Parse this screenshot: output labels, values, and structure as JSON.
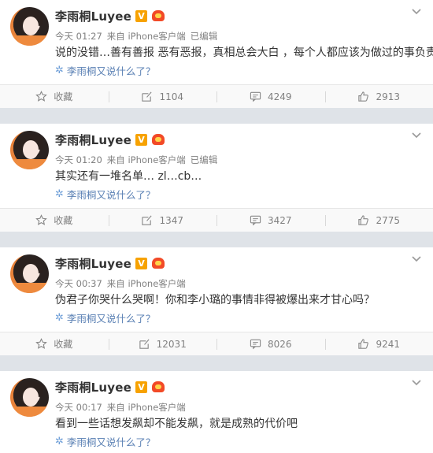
{
  "posts": [
    {
      "user": "李雨桐Luyee",
      "verified_badge": "V",
      "time": "今天 01:27",
      "source": "来自 iPhone客户端",
      "edited": "已编辑",
      "text": "说的没错…善有善报 恶有恶报，真相总会大白 ，每个人都应该为做过的事负责",
      "tag": "李雨桐又说什么了？",
      "actions": {
        "favorite": "收藏",
        "repost": "1104",
        "comment": "4249",
        "like": "2913"
      }
    },
    {
      "user": "李雨桐Luyee",
      "verified_badge": "V",
      "time": "今天 01:20",
      "source": "来自 iPhone客户端",
      "edited": "已编辑",
      "text": "其实还有一堆名单… zl…cb…",
      "tag": "李雨桐又说什么了？",
      "actions": {
        "favorite": "收藏",
        "repost": "1347",
        "comment": "3427",
        "like": "2775"
      }
    },
    {
      "user": "李雨桐Luyee",
      "verified_badge": "V",
      "time": "今天 00:37",
      "source": "来自 iPhone客户端",
      "edited": "",
      "text": "伪君子你哭什么哭啊！你和李小璐的事情非得被爆出来才甘心吗？",
      "tag": "李雨桐又说什么了？",
      "actions": {
        "favorite": "收藏",
        "repost": "12031",
        "comment": "8026",
        "like": "9241"
      }
    },
    {
      "user": "李雨桐Luyee",
      "verified_badge": "V",
      "time": "今天 00:17",
      "source": "来自 iPhone客户端",
      "edited": "",
      "text": "看到一些话想发飙却不能发飙，就是成熟的代价吧",
      "tag": "李雨桐又说什么了？"
    }
  ],
  "colors": {
    "background": "#dfe3e8",
    "card": "#ffffff",
    "link": "#5a80b4",
    "meta": "#808080",
    "verified": "#f7a200"
  },
  "icons": {
    "verified": "verified-badge-icon",
    "vip": "vip-crown-icon",
    "menu": "chevron-down-icon",
    "tag": "topic-sparkle-icon",
    "favorite": "star-icon",
    "repost": "repost-icon",
    "comment": "comment-icon",
    "like": "thumbs-up-icon"
  }
}
